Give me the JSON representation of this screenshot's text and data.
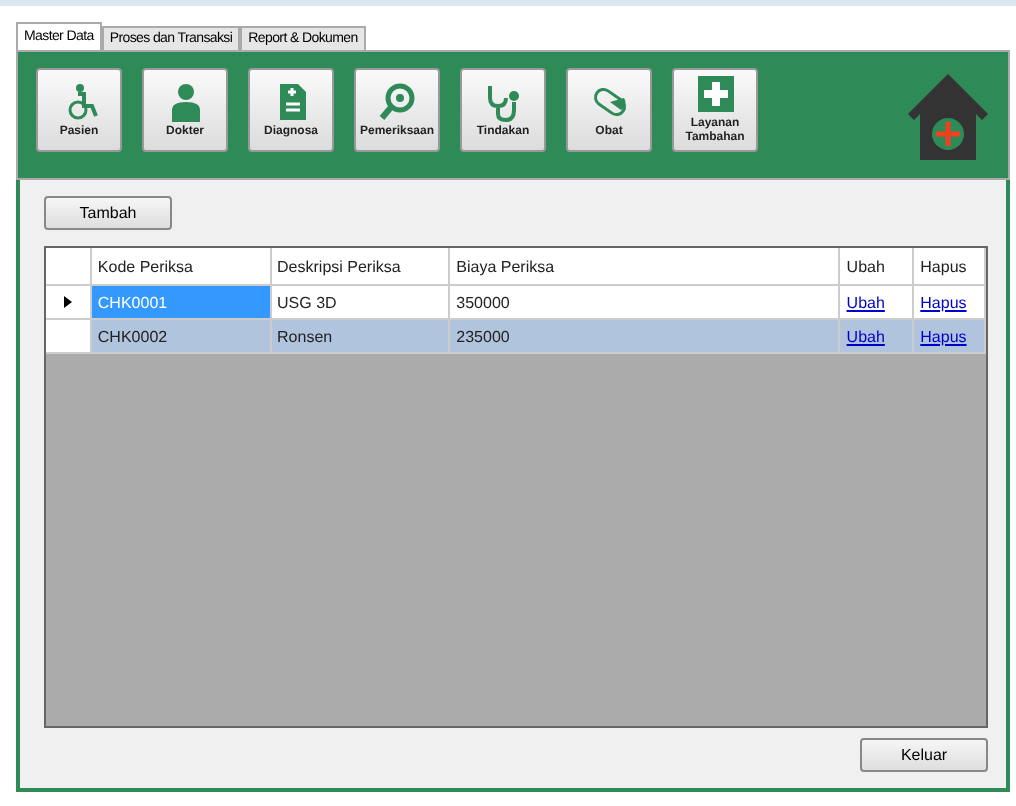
{
  "tabs": [
    {
      "label": "Master Data",
      "selected": true
    },
    {
      "label": "Proses dan Transaksi",
      "selected": false
    },
    {
      "label": "Report & Dokumen",
      "selected": false
    }
  ],
  "toolbar": [
    {
      "label": "Pasien",
      "kind": "wheelchair"
    },
    {
      "label": "Dokter",
      "kind": "doctor"
    },
    {
      "label": "Diagnosa",
      "kind": "document"
    },
    {
      "label": "Pemeriksaan",
      "kind": "magnifier"
    },
    {
      "label": "Tindakan",
      "kind": "stethoscope"
    },
    {
      "label": "Obat",
      "kind": "pill"
    },
    {
      "label": "Layanan Tambahan",
      "kind": "cross"
    }
  ],
  "add_button": "Tambah",
  "table": {
    "columns": [
      "Kode Periksa",
      "Deskripsi Periksa",
      "Biaya Periksa",
      "Ubah",
      "Hapus"
    ],
    "rows": [
      {
        "cells": [
          "CHK0001",
          "USG 3D",
          "350000"
        ],
        "edit": "Ubah",
        "delete": "Hapus",
        "selected": true
      },
      {
        "cells": [
          "CHK0002",
          "Ronsen",
          "235000"
        ],
        "edit": "Ubah",
        "delete": "Hapus",
        "selected": false
      }
    ]
  },
  "exit_button": "Keluar"
}
